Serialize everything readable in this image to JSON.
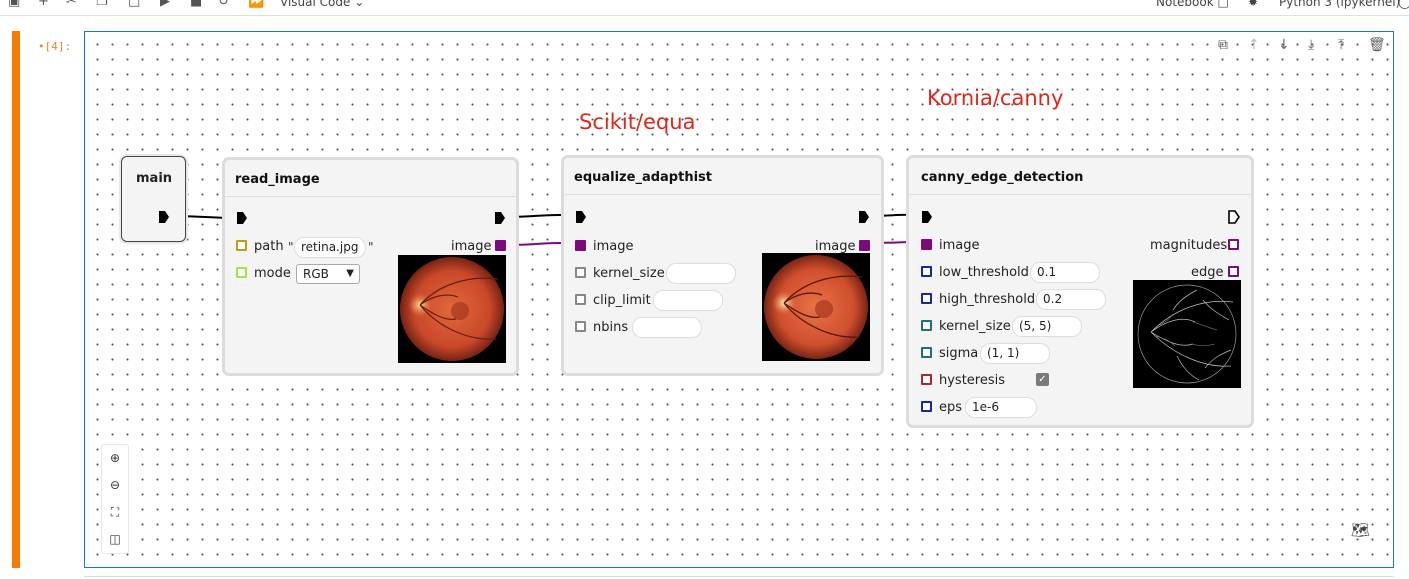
{
  "toolbar": {
    "kernel_selector": "Visual Code",
    "notebook_label": "Notebook",
    "kernel_name": "Python 3 (ipykernel)"
  },
  "cell": {
    "prompt": "•[4]:"
  },
  "annotations": {
    "scikit": "Scikit/equa",
    "kornia": "Kornia/canny"
  },
  "nodes": {
    "main": {
      "title": "main"
    },
    "read_image": {
      "title": "read_image",
      "path_label": "path",
      "path_value": "retina.jpg",
      "quote": "\"",
      "mode_label": "mode",
      "mode_value": "RGB",
      "output_label": "image"
    },
    "equalize": {
      "title": "equalize_adapthist",
      "input_label": "image",
      "kernel_size_label": "kernel_size",
      "clip_limit_label": "clip_limit",
      "nbins_label": "nbins",
      "output_label": "image"
    },
    "canny": {
      "title": "canny_edge_detection",
      "image_label": "image",
      "low_threshold_label": "low_threshold",
      "low_threshold_value": "0.1",
      "high_threshold_label": "high_threshold",
      "high_threshold_value": "0.2",
      "kernel_size_label": "kernel_size",
      "kernel_size_value": "(5, 5)",
      "sigma_label": "sigma",
      "sigma_value": "(1, 1)",
      "hysteresis_label": "hysteresis",
      "hysteresis_checked": true,
      "eps_label": "eps",
      "eps_value": "1e-6",
      "magnitudes_label": "magnitudes",
      "edge_label": "edge"
    }
  },
  "colors": {
    "image_port": "#7b0b7b",
    "path_port": "#b5a21a",
    "mode_port": "#a6e34a",
    "gray_port": "#888888",
    "blue_port": "#1a24a8",
    "teal_port": "#1f6f7a",
    "red_port": "#b0262a",
    "annotation": "#e0261b",
    "cell_bar": "#f57c00",
    "canvas_border": "#1976d2"
  }
}
